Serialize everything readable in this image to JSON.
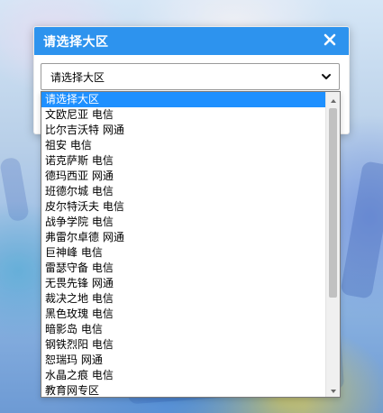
{
  "dialog": {
    "title": "请选择大区"
  },
  "select": {
    "value": "请选择大区"
  },
  "dropdown": {
    "selected_index": 0,
    "options": [
      "请选择大区",
      "文欧尼亚 电信",
      "比尔吉沃特 网通",
      "祖安 电信",
      "诺克萨斯 电信",
      "德玛西亚 网通",
      "班德尔城 电信",
      "皮尔特沃夫 电信",
      "战争学院 电信",
      "弗雷尔卓德 网通",
      "巨神峰 电信",
      "雷瑟守备 电信",
      "无畏先锋 网通",
      "裁决之地 电信",
      "黑色玫瑰 电信",
      "暗影岛 电信",
      "钢铁烈阳 电信",
      "恕瑞玛 网通",
      "水晶之痕 电信",
      "教育网专区"
    ]
  },
  "icons": {
    "close": "close-icon",
    "caret": "chevron-down-icon",
    "scroll_up": "scroll-up-icon",
    "scroll_down": "scroll-down-icon"
  },
  "colors": {
    "header_bg": "#2d93ee",
    "selected_bg": "#1e90ff"
  }
}
